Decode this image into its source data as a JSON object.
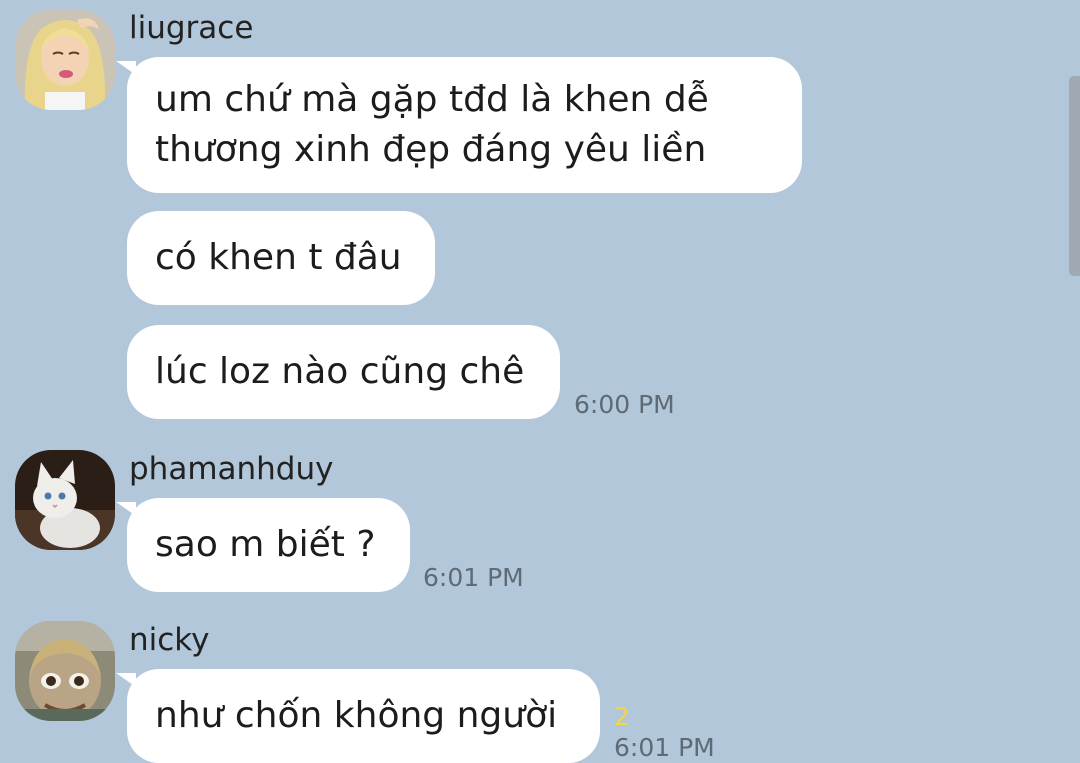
{
  "messages": [
    {
      "sender": "liugrace",
      "avatar_icon": "blonde-doll-avatar-icon",
      "bubbles": [
        {
          "lines": [
            "um chứ mà gặp tđd là khen dễ",
            "thương xinh đẹp đáng yêu liền"
          ]
        },
        {
          "lines": [
            "có khen t đâu"
          ]
        },
        {
          "lines": [
            "lúc loz nào cũng chê"
          ],
          "time": "6:00 PM"
        }
      ]
    },
    {
      "sender": "phamanhduy",
      "avatar_icon": "white-kitten-avatar-icon",
      "bubbles": [
        {
          "lines": [
            "sao m biết ?"
          ],
          "time": "6:01 PM"
        }
      ]
    },
    {
      "sender": "nicky",
      "avatar_icon": "distorted-face-avatar-icon",
      "bubbles": [
        {
          "lines": [
            "như chốn không người"
          ],
          "unread": "2",
          "time": "6:01 PM"
        }
      ]
    }
  ],
  "colors": {
    "background": "#b2c7d9",
    "bubble": "#ffffff",
    "time": "#5e6a76",
    "unread": "#f1d64a"
  }
}
